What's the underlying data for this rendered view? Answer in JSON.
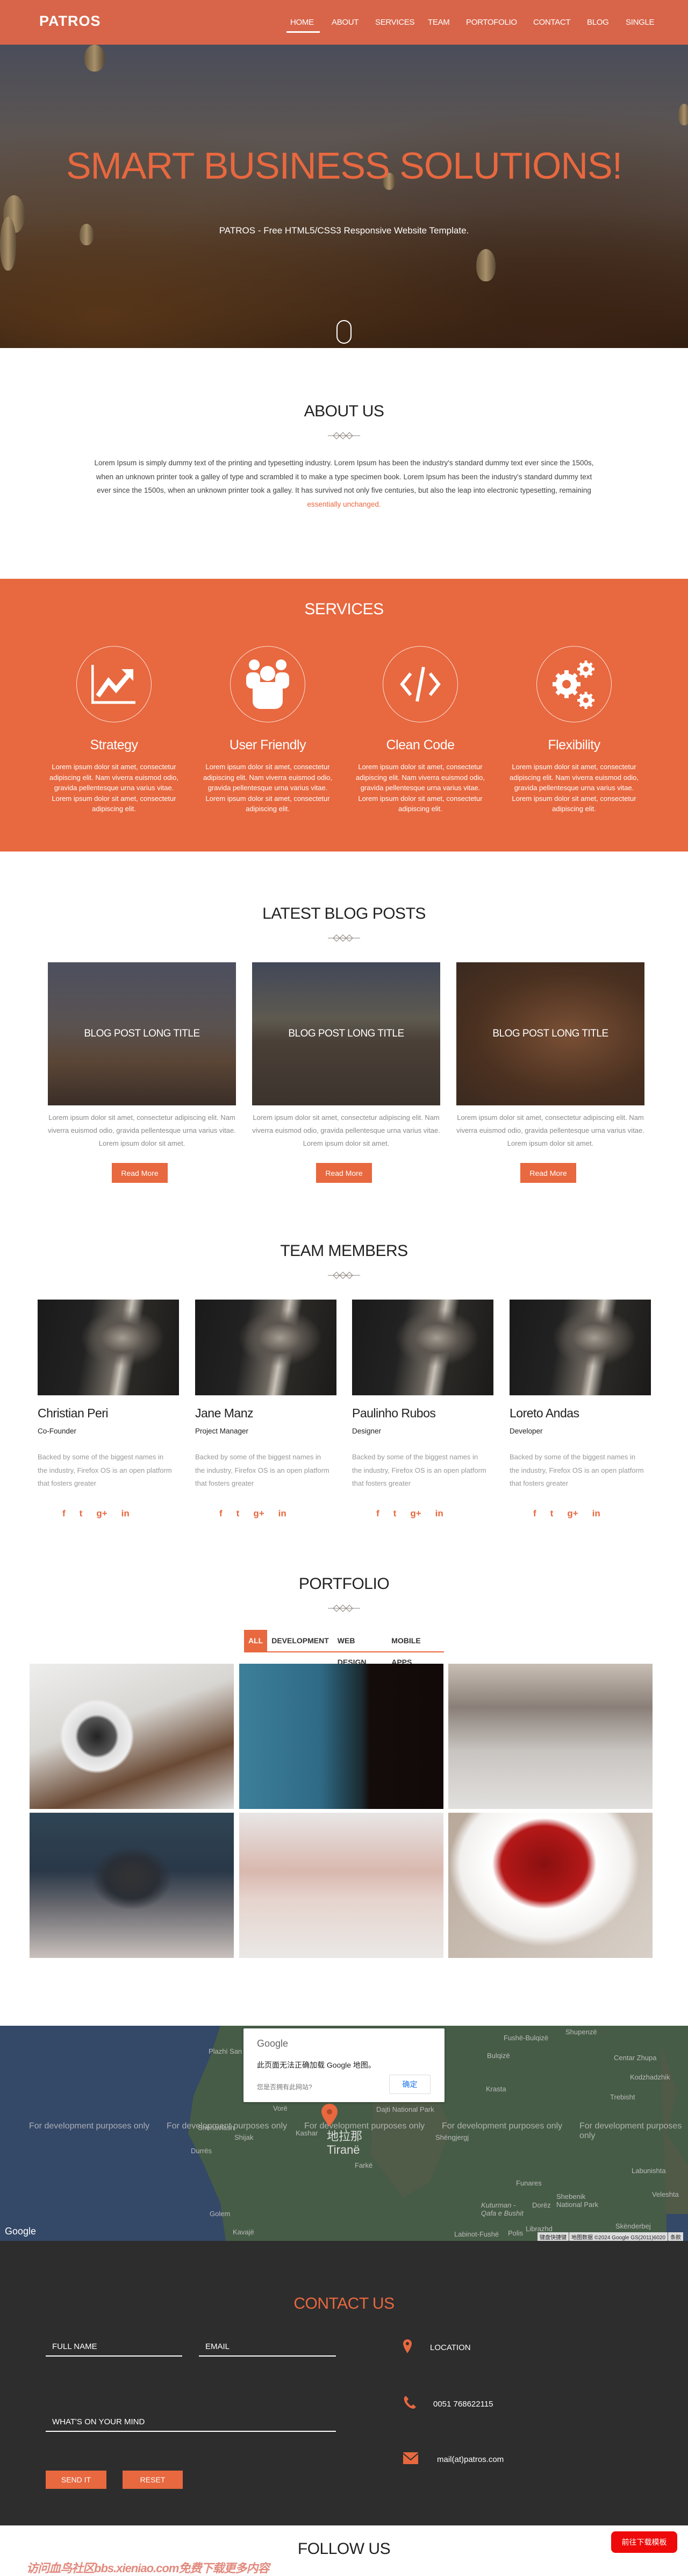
{
  "header": {
    "logo": "PATROS",
    "nav": [
      "HOME",
      "ABOUT",
      "SERVICES",
      "TEAM",
      "PORTOFOLIO",
      "CONTACT",
      "BLOG",
      "SINGLE"
    ],
    "active": "HOME"
  },
  "hero": {
    "title": "SMART BUSINESS SOLUTIONS!",
    "subtitle": "PATROS - Free HTML5/CSS3 Responsive Website Template.",
    "scroll_icon": "mouse-icon"
  },
  "about": {
    "title": "ABOUT US",
    "text": "Lorem Ipsum is simply dummy text of the printing and typesetting industry. Lorem Ipsum has been the industry's standard dummy text ever since the 1500s, when an unknown printer took a galley of type and scrambled it to make a type specimen book. Lorem Ipsum has been the industry's standard dummy text ever since the 1500s, when an unknown printer took a galley. It has survived not only five centuries, but also the leap into electronic typesetting, remaining ",
    "link": "essentially unchanged."
  },
  "services": {
    "title": "SERVICES",
    "items": [
      {
        "icon": "chart-line-icon",
        "title": "Strategy",
        "text": "Lorem ipsum dolor sit amet, consectetur adipiscing elit. Nam viverra euismod odio, gravida pellentesque urna varius vitae. Lorem ipsum dolor sit amet, consectetur adipiscing elit."
      },
      {
        "icon": "users-icon",
        "title": "User Friendly",
        "text": "Lorem ipsum dolor sit amet, consectetur adipiscing elit. Nam viverra euismod odio, gravida pellentesque urna varius vitae. Lorem ipsum dolor sit amet, consectetur adipiscing elit."
      },
      {
        "icon": "code-icon",
        "title": "Clean Code",
        "text": "Lorem ipsum dolor sit amet, consectetur adipiscing elit. Nam viverra euismod odio, gravida pellentesque urna varius vitae. Lorem ipsum dolor sit amet, consectetur adipiscing elit."
      },
      {
        "icon": "gears-icon",
        "title": "Flexibility",
        "text": "Lorem ipsum dolor sit amet, consectetur adipiscing elit. Nam viverra euismod odio, gravida pellentesque urna varius vitae. Lorem ipsum dolor sit amet, consectetur adipiscing elit."
      }
    ]
  },
  "blog": {
    "title": "LATEST BLOG POSTS",
    "posts": [
      {
        "title": "BLOG POST LONG TITLE",
        "text": "Lorem ipsum dolor sit amet, consectetur adipiscing elit. Nam viverra euismod odio, gravida pellentesque urna varius vitae. Lorem ipsum dolor sit amet.",
        "button": "Read More"
      },
      {
        "title": "BLOG POST LONG TITLE",
        "text": "Lorem ipsum dolor sit amet, consectetur adipiscing elit. Nam viverra euismod odio, gravida pellentesque urna varius vitae. Lorem ipsum dolor sit amet.",
        "button": "Read More"
      },
      {
        "title": "BLOG POST LONG TITLE",
        "text": "Lorem ipsum dolor sit amet, consectetur adipiscing elit. Nam viverra euismod odio, gravida pellentesque urna varius vitae. Lorem ipsum dolor sit amet.",
        "button": "Read More"
      }
    ]
  },
  "team": {
    "title": "TEAM MEMBERS",
    "members": [
      {
        "name": "Christian Peri",
        "role": "Co-Founder",
        "text": "Backed by some of the biggest names in the industry, Firefox OS is an open platform that fosters greater"
      },
      {
        "name": "Jane Manz",
        "role": "Project Manager",
        "text": "Backed by some of the biggest names in the industry, Firefox OS is an open platform that fosters greater"
      },
      {
        "name": "Paulinho Rubos",
        "role": "Designer",
        "text": "Backed by some of the biggest names in the industry, Firefox OS is an open platform that fosters greater"
      },
      {
        "name": "Loreto Andas",
        "role": "Developer",
        "text": "Backed by some of the biggest names in the industry, Firefox OS is an open platform that fosters greater"
      }
    ],
    "social": [
      "f",
      "t",
      "g+",
      "in"
    ]
  },
  "portfolio": {
    "title": "PORTFOLIO",
    "tabs": [
      "ALL",
      "DEVELOPMENT",
      "WEB DESIGN",
      "MOBILE APPS"
    ],
    "active_tab": "ALL"
  },
  "map": {
    "dialog_brand": "Google",
    "dialog_message": "此页面无法正确加载 Google 地图。",
    "dialog_question": "您是否拥有此网站?",
    "dialog_ok": "确定",
    "watermark": "For development purposes only",
    "logo": "Google",
    "attribution": [
      "键盘快捷键",
      "地图数据 ©2024 Google GS(2011)6020",
      "条款"
    ],
    "labels": [
      "Plazhi San Pietro",
      "Fushë-Bulqizë",
      "Shupenzë",
      "Bulqizë",
      "Centar Zhupa",
      "Kodzhadzhik",
      "Krasta",
      "Trebisht",
      "Vorë",
      "Dajti National Park",
      "Shënavlash",
      "Shijak",
      "Durrës",
      "Kashar",
      "地拉那",
      "Tiranë",
      "Farkë",
      "Shëngjergj",
      "Funares",
      "Shebenik National Park",
      "Labunishta",
      "Veleshta",
      "Golem",
      "Kavajë",
      "Kuturman - Qafa e Bushit",
      "Dorëz",
      "Librazhd",
      "Labinot-Fushë",
      "Polis",
      "Skënderbej"
    ]
  },
  "contact": {
    "title": "CONTACT US",
    "fields": {
      "name": "FULL NAME",
      "email": "EMAIL",
      "message": "WHAT'S ON YOUR MIND"
    },
    "send": "SEND IT",
    "reset": "RESET",
    "location": "LOCATION",
    "phone": "0051 768622115",
    "email": "mail(at)patros.com"
  },
  "follow": {
    "title": "FOLLOW US"
  },
  "overlay": {
    "download_button": "前往下载模板",
    "watermark": "访问血鸟社区bbs.xieniao.com免费下载更多内容"
  },
  "colors": {
    "accent": "#e8683f",
    "header": "#d8654a",
    "dark": "#2d2d2d"
  }
}
